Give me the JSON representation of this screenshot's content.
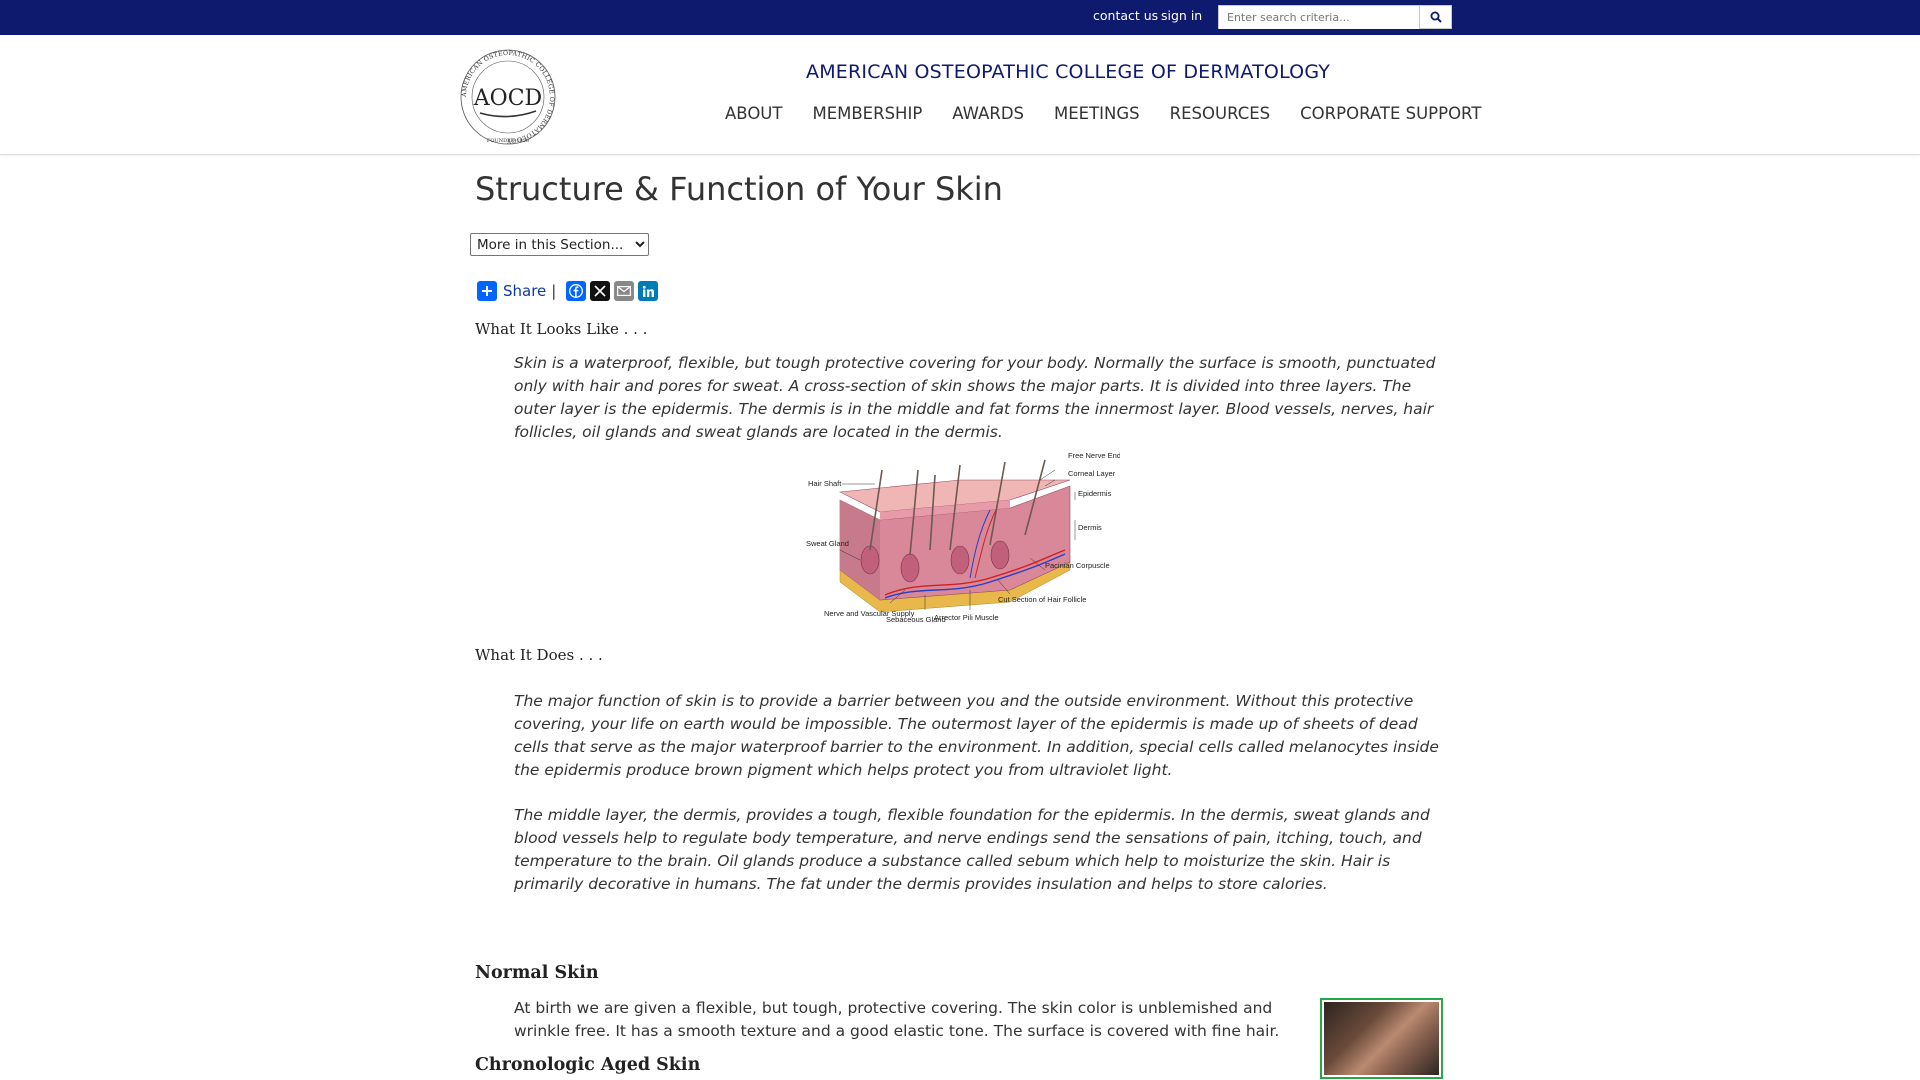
{
  "topbar": {
    "contact_label": "contact us",
    "signin_label": "sign in",
    "search_placeholder": "Enter search criteria...",
    "search_icon": "search-icon"
  },
  "header": {
    "site_title": "AMERICAN OSTEOPATHIC COLLEGE OF DERMATOLOGY",
    "logo_text": "AOCD",
    "logo_ring_text": "AMERICAN OSTEOPATHIC COLLEGE OF DERMATOLOGY",
    "logo_founded": "FOUNDED 1958",
    "nav": [
      {
        "label": "ABOUT"
      },
      {
        "label": "MEMBERSHIP"
      },
      {
        "label": "AWARDS"
      },
      {
        "label": "MEETINGS"
      },
      {
        "label": "RESOURCES"
      },
      {
        "label": "CORPORATE SUPPORT"
      }
    ]
  },
  "page": {
    "title": "Structure & Function of Your Skin",
    "section_select": "More in this Section...",
    "share_label": "Share",
    "share_separator": "|",
    "share_icons": [
      "share-plus-icon",
      "facebook-icon",
      "x-icon",
      "email-icon",
      "linkedin-icon"
    ],
    "looks_like_heading": "What It Looks Like . . .",
    "looks_like_text": "Skin is a waterproof, flexible, but tough protective covering for your body. Normally the surface is smooth, punctuated only with hair and pores for sweat. A cross-section of skin shows the major parts. It is divided into three layers. The outer layer is the epidermis. The dermis is in the middle and fat forms the innermost layer. Blood vessels, nerves, hair follicles, oil glands and sweat glands are located in the dermis.",
    "diagram_labels": {
      "free_nerve_ending": "Free Nerve Ending",
      "corneal_layer": "Corneal Layer",
      "epidermis": "Epidermis",
      "dermis": "Dermis",
      "hair_shaft": "Hair Shaft",
      "sweat_gland": "Sweat Gland",
      "pacinian_corpuscle": "Pacinian Corpuscle",
      "cut_section": "Cut Section of Hair Follicle",
      "nerve_vascular": "Nerve and Vascular Supply",
      "sebaceous_gland": "Sebaceous Gland",
      "arrector_pili": "Arrector Pili Muscle"
    },
    "does_heading": "What It Does . . .",
    "does_text_1": "The major function of skin is to provide a barrier between you and the outside environment. Without this protective covering, your life on earth would be impossible. The outermost layer of the epidermis is made up of sheets of dead cells that serve as the major waterproof barrier to the environment. In addition, special cells called melanocytes inside the epidermis produce brown pigment which helps protect you from ultraviolet light.",
    "does_text_2": "The middle layer, the dermis, provides a tough, flexible foundation for the epidermis. In the dermis, sweat glands and blood vessels help to regulate body temperature, and nerve endings send the sensations of pain, itching, touch, and temperature to the brain. Oil glands produce a substance called sebum which help to moisturize the skin. Hair is primarily decorative in humans. The fat under the dermis provides insulation and helps to store calories.",
    "normal_heading": "Normal Skin",
    "normal_text": "At birth we are given a flexible, but tough, protective covering. The skin color is unblemished and wrinkle free. It has a smooth texture and a good elastic tone. The surface is covered with fine hair.",
    "aged_heading": "Chronologic Aged Skin"
  },
  "colors": {
    "topbar_bg": "#0d1a6e",
    "title_color": "#0d1a6e",
    "share_blue": "#0166ff",
    "thumb_border": "#27a844"
  }
}
